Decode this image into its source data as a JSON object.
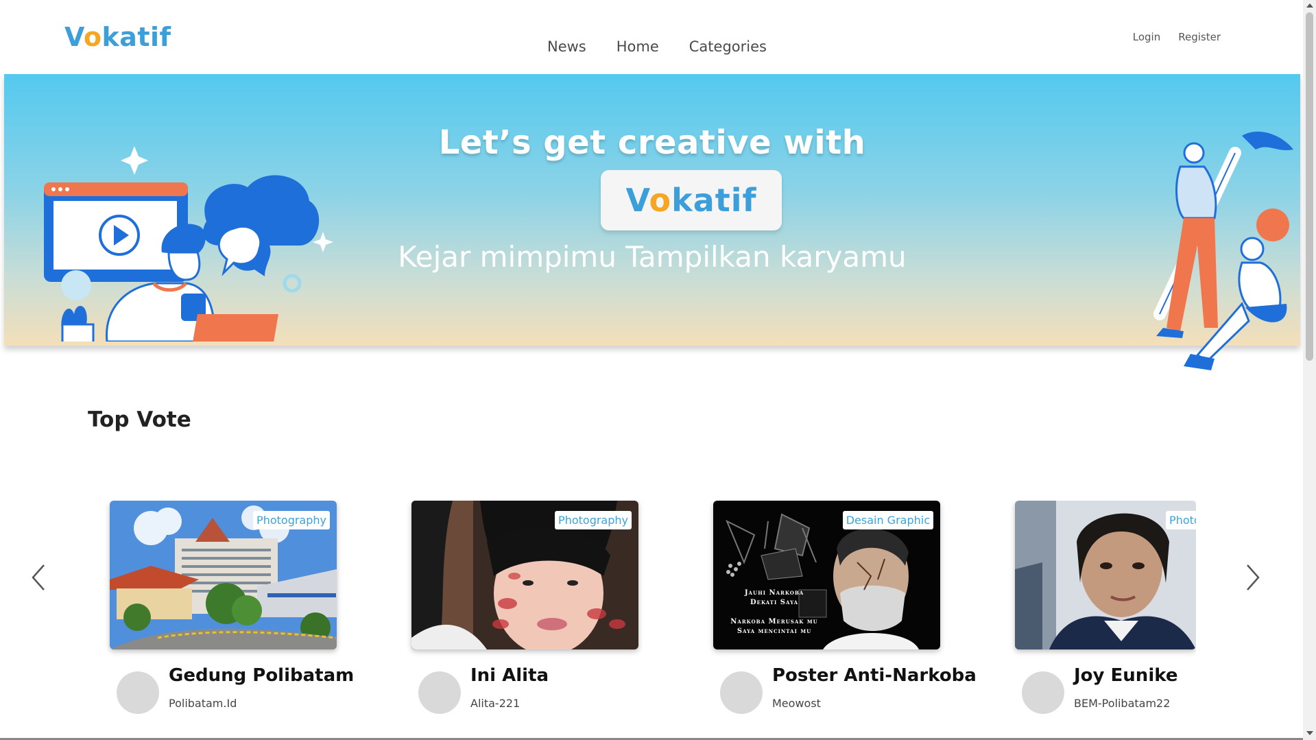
{
  "navbar": {
    "logo": {
      "pre": "V",
      "o": "o",
      "post": "katif"
    },
    "links": [
      "News",
      "Home",
      "Categories"
    ],
    "login": "Login",
    "register": "Register"
  },
  "hero": {
    "title": "Let’s get creative with",
    "logo": {
      "pre": "V",
      "o": "o",
      "post": "katif"
    },
    "subtitle": "Kejar mimpimu Tampilkan karyamu"
  },
  "top_vote": {
    "title": "Top Vote",
    "cards": [
      {
        "title": "Gedung Polibatam",
        "author": "Polibatam.Id",
        "category": "Photography"
      },
      {
        "title": "Ini Alita",
        "author": "Alita-221",
        "category": "Photography"
      },
      {
        "title": "Poster Anti-Narkoba",
        "author": "Meowost",
        "category": "Desain Graphic",
        "poster_text": [
          "Jauhi Narkoba",
          "Dekati Saya",
          "Narkoba Merusak mu",
          "Saya mencintai mu"
        ]
      },
      {
        "title": "Joy Eunike",
        "author": "BEM-Polibatam22",
        "category": "Photography"
      }
    ]
  },
  "colors": {
    "brand_blue": "#3d9fd9",
    "brand_orange": "#f5a623",
    "badge_text": "#3ba3d9"
  },
  "icons": {
    "prev": "chevron-left-icon",
    "next": "chevron-right-icon"
  }
}
